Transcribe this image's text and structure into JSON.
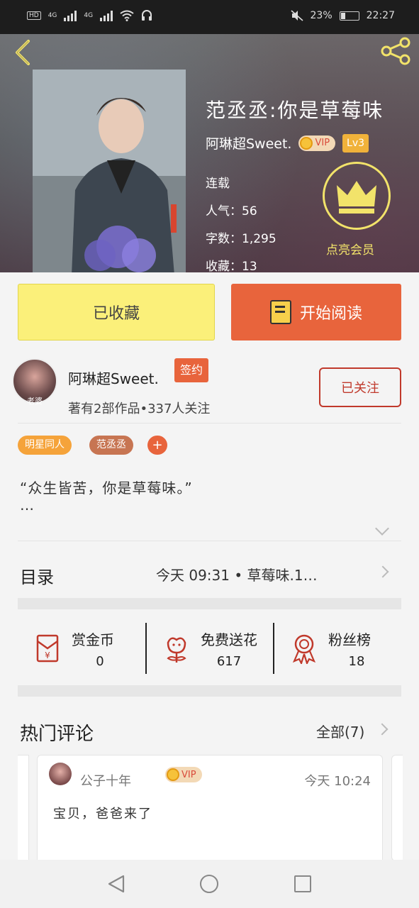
{
  "status_bar": {
    "network1": "4G",
    "network2": "4G",
    "hd": "HD",
    "battery": "23%",
    "time": "22:27"
  },
  "book": {
    "title": "范丞丞:你是草莓味",
    "author": "阿琳超Sweet.",
    "vip": "VIP",
    "level": "Lv3",
    "status": "连载",
    "popularity_label": "人气：",
    "popularity": "56",
    "words_label": "字数：",
    "words": "1,295",
    "favorites_label": "收藏：",
    "favorites": "13",
    "member_label": "点亮会员"
  },
  "actions": {
    "collected": "已收藏",
    "start_reading": "开始阅读"
  },
  "author_card": {
    "name": "阿琳超Sweet.",
    "avatar_caption": "老婆",
    "contract_tag": "签约",
    "follow": "已关注",
    "works": "著有2部作品•337人关注"
  },
  "tags": [
    "明星同人",
    "范丞丞",
    "+"
  ],
  "intro": {
    "text": "“众生皆苦，你是草莓味。”",
    "more": "…"
  },
  "toc": {
    "label": "目录",
    "latest": "今天 09:31 • 草莓味.1…"
  },
  "stats": [
    {
      "name": "赏金币",
      "value": "0",
      "icon": "red-envelope-icon"
    },
    {
      "name": "免费送花",
      "value": "617",
      "icon": "flower-icon"
    },
    {
      "name": "粉丝榜",
      "value": "18",
      "icon": "medal-icon"
    }
  ],
  "hot": {
    "title": "热门评论",
    "all": "全部(7)"
  },
  "comment": {
    "user": "公子十年",
    "vip": "VIP",
    "time": "今天 10:24",
    "text": "宝贝，爸爸来了"
  },
  "colors": {
    "accent": "#e8643c",
    "collected_bg": "#fbf07a",
    "follow": "#c0392b",
    "crown": "#f2e36a"
  }
}
